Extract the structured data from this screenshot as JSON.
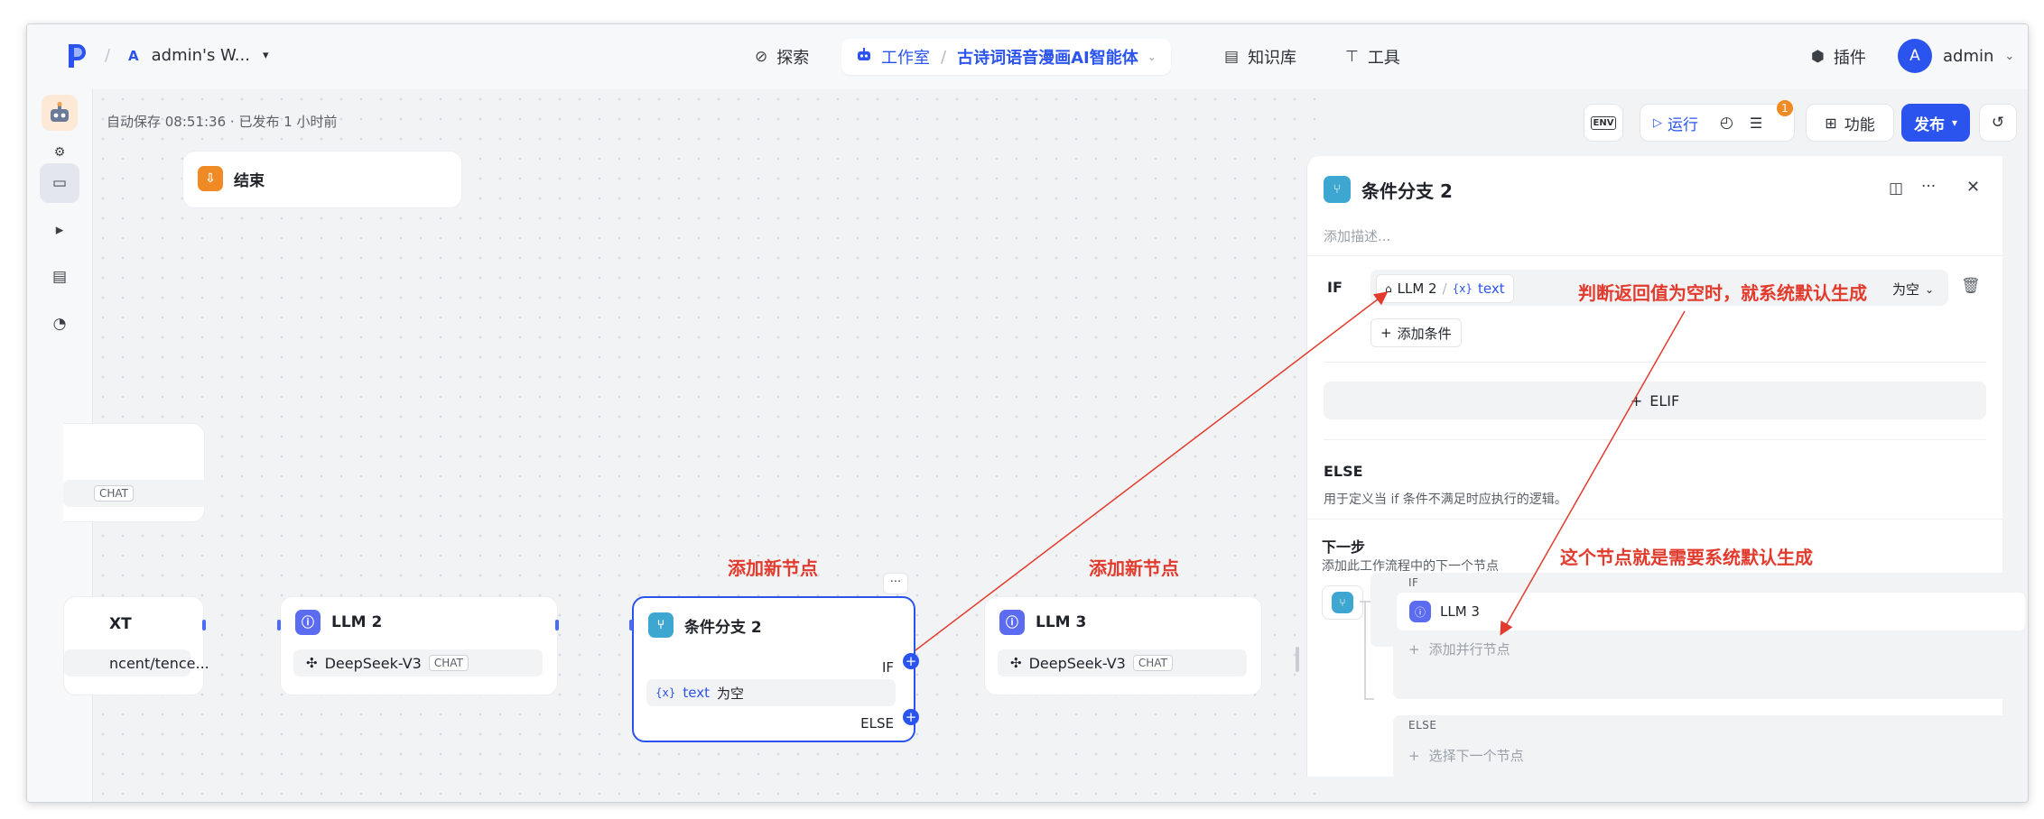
{
  "app": {
    "workspace_letter": "A",
    "workspace_name": "admin's W...",
    "workspace_chevron": "⌄"
  },
  "nav": {
    "explore": "探索",
    "studio": "工作室",
    "project": "古诗词语音漫画AI智能体",
    "knowledge": "知识库",
    "tools": "工具",
    "plugins": "插件",
    "user_initial": "A",
    "user_name": "admin"
  },
  "toolbar": {
    "autosave": "自动保存 08:51:36 · 已发布 1 小时前",
    "env": "ENV",
    "run": "运行",
    "badge_count": "1",
    "features": "功能",
    "publish": "发布"
  },
  "nodes": {
    "end": {
      "title": "结束"
    },
    "partial_top": {
      "tag": "CHAT"
    },
    "partial_left": {
      "title": "XT",
      "value": "ncent/tence..."
    },
    "llm2": {
      "title": "LLM 2",
      "model": "DeepSeek-V3",
      "tag": "CHAT"
    },
    "cond2": {
      "title": "条件分支 2",
      "if_label": "IF",
      "var_name": "text",
      "condition_op": "为空",
      "else_label": "ELSE",
      "more": "···"
    },
    "llm3": {
      "title": "LLM 3",
      "model": "DeepSeek-V3",
      "tag": "CHAT"
    }
  },
  "annotations": {
    "add_node_1": "添加新节点",
    "add_node_2": "添加新节点",
    "judge_note": "判断返回值为空时，就系统默认生成",
    "node_note": "这个节点就是需要系统默认生成"
  },
  "panel": {
    "title": "条件分支 2",
    "description_placeholder": "添加描述...",
    "if_label": "IF",
    "cond_node": "LLM 2",
    "cond_sep": "/",
    "cond_var_icon": "{x}",
    "cond_var": "text",
    "cond_op": "为空",
    "add_condition": "添加条件",
    "elif": "ELIF",
    "else_title": "ELSE",
    "else_desc": "用于定义当 if 条件不满足时应执行的逻辑。",
    "next_title": "下一步",
    "next_desc": "添加此工作流程中的下一个节点",
    "branch_if": "IF",
    "branch_if_node": "LLM 3",
    "add_parallel": "添加并行节点",
    "branch_else": "ELSE",
    "select_next": "选择下一个节点"
  }
}
